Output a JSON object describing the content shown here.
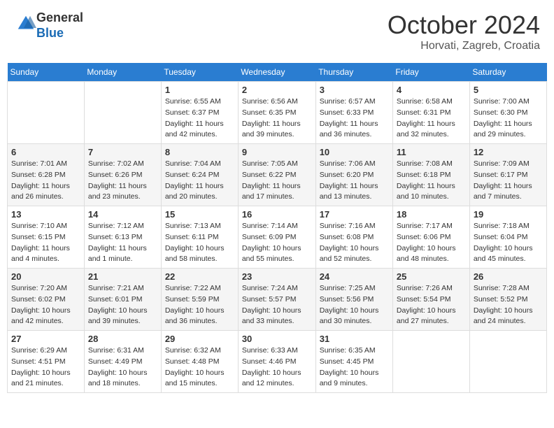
{
  "header": {
    "logo_line1": "General",
    "logo_line2": "Blue",
    "month": "October 2024",
    "location": "Horvati, Zagreb, Croatia"
  },
  "weekdays": [
    "Sunday",
    "Monday",
    "Tuesday",
    "Wednesday",
    "Thursday",
    "Friday",
    "Saturday"
  ],
  "weeks": [
    [
      {
        "day": "",
        "info": ""
      },
      {
        "day": "",
        "info": ""
      },
      {
        "day": "1",
        "info": "Sunrise: 6:55 AM\nSunset: 6:37 PM\nDaylight: 11 hours and 42 minutes."
      },
      {
        "day": "2",
        "info": "Sunrise: 6:56 AM\nSunset: 6:35 PM\nDaylight: 11 hours and 39 minutes."
      },
      {
        "day": "3",
        "info": "Sunrise: 6:57 AM\nSunset: 6:33 PM\nDaylight: 11 hours and 36 minutes."
      },
      {
        "day": "4",
        "info": "Sunrise: 6:58 AM\nSunset: 6:31 PM\nDaylight: 11 hours and 32 minutes."
      },
      {
        "day": "5",
        "info": "Sunrise: 7:00 AM\nSunset: 6:30 PM\nDaylight: 11 hours and 29 minutes."
      }
    ],
    [
      {
        "day": "6",
        "info": "Sunrise: 7:01 AM\nSunset: 6:28 PM\nDaylight: 11 hours and 26 minutes."
      },
      {
        "day": "7",
        "info": "Sunrise: 7:02 AM\nSunset: 6:26 PM\nDaylight: 11 hours and 23 minutes."
      },
      {
        "day": "8",
        "info": "Sunrise: 7:04 AM\nSunset: 6:24 PM\nDaylight: 11 hours and 20 minutes."
      },
      {
        "day": "9",
        "info": "Sunrise: 7:05 AM\nSunset: 6:22 PM\nDaylight: 11 hours and 17 minutes."
      },
      {
        "day": "10",
        "info": "Sunrise: 7:06 AM\nSunset: 6:20 PM\nDaylight: 11 hours and 13 minutes."
      },
      {
        "day": "11",
        "info": "Sunrise: 7:08 AM\nSunset: 6:18 PM\nDaylight: 11 hours and 10 minutes."
      },
      {
        "day": "12",
        "info": "Sunrise: 7:09 AM\nSunset: 6:17 PM\nDaylight: 11 hours and 7 minutes."
      }
    ],
    [
      {
        "day": "13",
        "info": "Sunrise: 7:10 AM\nSunset: 6:15 PM\nDaylight: 11 hours and 4 minutes."
      },
      {
        "day": "14",
        "info": "Sunrise: 7:12 AM\nSunset: 6:13 PM\nDaylight: 11 hours and 1 minute."
      },
      {
        "day": "15",
        "info": "Sunrise: 7:13 AM\nSunset: 6:11 PM\nDaylight: 10 hours and 58 minutes."
      },
      {
        "day": "16",
        "info": "Sunrise: 7:14 AM\nSunset: 6:09 PM\nDaylight: 10 hours and 55 minutes."
      },
      {
        "day": "17",
        "info": "Sunrise: 7:16 AM\nSunset: 6:08 PM\nDaylight: 10 hours and 52 minutes."
      },
      {
        "day": "18",
        "info": "Sunrise: 7:17 AM\nSunset: 6:06 PM\nDaylight: 10 hours and 48 minutes."
      },
      {
        "day": "19",
        "info": "Sunrise: 7:18 AM\nSunset: 6:04 PM\nDaylight: 10 hours and 45 minutes."
      }
    ],
    [
      {
        "day": "20",
        "info": "Sunrise: 7:20 AM\nSunset: 6:02 PM\nDaylight: 10 hours and 42 minutes."
      },
      {
        "day": "21",
        "info": "Sunrise: 7:21 AM\nSunset: 6:01 PM\nDaylight: 10 hours and 39 minutes."
      },
      {
        "day": "22",
        "info": "Sunrise: 7:22 AM\nSunset: 5:59 PM\nDaylight: 10 hours and 36 minutes."
      },
      {
        "day": "23",
        "info": "Sunrise: 7:24 AM\nSunset: 5:57 PM\nDaylight: 10 hours and 33 minutes."
      },
      {
        "day": "24",
        "info": "Sunrise: 7:25 AM\nSunset: 5:56 PM\nDaylight: 10 hours and 30 minutes."
      },
      {
        "day": "25",
        "info": "Sunrise: 7:26 AM\nSunset: 5:54 PM\nDaylight: 10 hours and 27 minutes."
      },
      {
        "day": "26",
        "info": "Sunrise: 7:28 AM\nSunset: 5:52 PM\nDaylight: 10 hours and 24 minutes."
      }
    ],
    [
      {
        "day": "27",
        "info": "Sunrise: 6:29 AM\nSunset: 4:51 PM\nDaylight: 10 hours and 21 minutes."
      },
      {
        "day": "28",
        "info": "Sunrise: 6:31 AM\nSunset: 4:49 PM\nDaylight: 10 hours and 18 minutes."
      },
      {
        "day": "29",
        "info": "Sunrise: 6:32 AM\nSunset: 4:48 PM\nDaylight: 10 hours and 15 minutes."
      },
      {
        "day": "30",
        "info": "Sunrise: 6:33 AM\nSunset: 4:46 PM\nDaylight: 10 hours and 12 minutes."
      },
      {
        "day": "31",
        "info": "Sunrise: 6:35 AM\nSunset: 4:45 PM\nDaylight: 10 hours and 9 minutes."
      },
      {
        "day": "",
        "info": ""
      },
      {
        "day": "",
        "info": ""
      }
    ]
  ]
}
